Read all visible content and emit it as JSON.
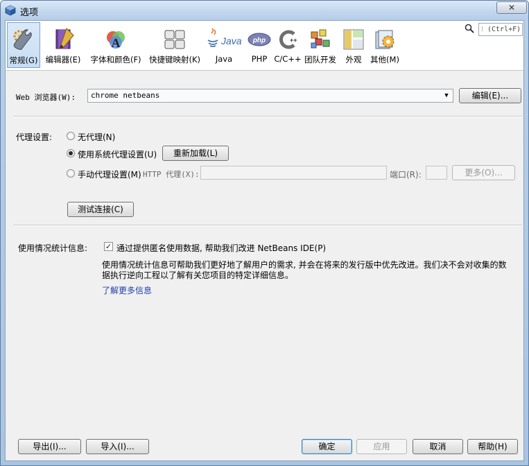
{
  "window": {
    "title": "选项",
    "close_glyph": "✕"
  },
  "toolbar": {
    "items": [
      {
        "label": "常规(G)",
        "icon": "general-icon",
        "active": true
      },
      {
        "label": "编辑器(E)",
        "icon": "editor-icon"
      },
      {
        "label": "字体和颜色(F)",
        "icon": "fonts-colors-icon"
      },
      {
        "label": "快捷键映射(K)",
        "icon": "keymap-icon"
      },
      {
        "label": "Java",
        "icon": "java-icon"
      },
      {
        "label": "PHP",
        "icon": "php-icon"
      },
      {
        "label": "C/C++",
        "icon": "cpp-icon"
      },
      {
        "label": "团队开发",
        "icon": "team-icon"
      },
      {
        "label": "外观",
        "icon": "appearance-icon"
      },
      {
        "label": "其他(M)",
        "icon": "misc-icon"
      }
    ],
    "search_placeholder": "(Ctrl+F)"
  },
  "browser": {
    "label": "Web 浏览器(W):",
    "value": "chrome netbeans",
    "edit_button": "编辑(E)..."
  },
  "proxy": {
    "label": "代理设置:",
    "options": {
      "none": "无代理(N)",
      "system": "使用系统代理设置(U)",
      "manual": "手动代理设置(M)"
    },
    "selected": "system",
    "reload_button": "重新加载(L)",
    "http_label": "HTTP 代理(X):",
    "http_value": "",
    "port_label": "端口(R):",
    "port_value": "",
    "more_button": "更多(O)...",
    "test_button": "测试连接(C)"
  },
  "usage": {
    "label": "使用情况统计信息:",
    "checkbox_label": "通过提供匿名使用数据, 帮助我们改进 NetBeans IDE(P)",
    "checked": true,
    "description_line1": "使用情况统计信息可帮助我们更好地了解用户的需求, 并会在将来的发行版中优先改进。我们决不会对收集的数",
    "description_line2": "据执行逆向工程以了解有关您项目的特定详细信息。",
    "learn_more": "了解更多信息"
  },
  "footer": {
    "export": "导出(I)...",
    "import": "导入(I)...",
    "ok": "确定",
    "apply": "应用",
    "cancel": "取消",
    "help": "帮助(H)"
  },
  "colors": {
    "titlebar": "#c2d7ee",
    "active_tab": "#c7ddf4",
    "link": "#1f3fa8",
    "dialog_bg": "#f0f0f0"
  }
}
